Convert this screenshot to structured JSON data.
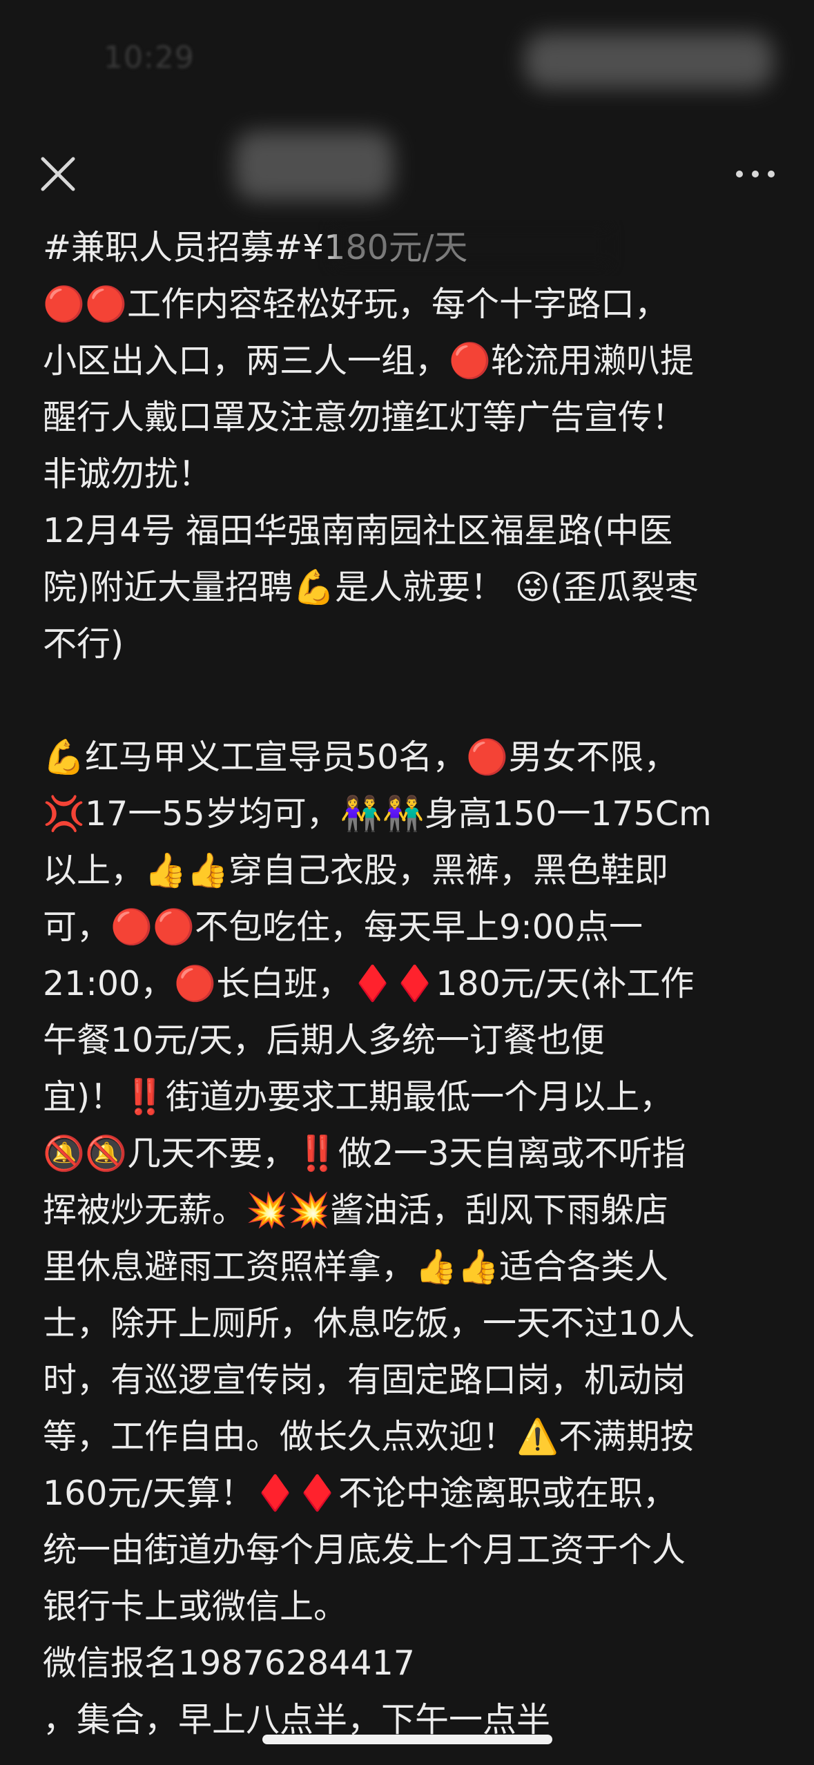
{
  "status_bar": {
    "time": "10:29"
  },
  "nav": {
    "close_icon": "close-icon",
    "more_icon": "more-icon"
  },
  "post": {
    "lines": [
      "#兼职人员招募#¥180元/天",
      "🔴🔴工作内容轻松好玩，每个十字路口，",
      "小区出入口，两三人一组，🔴轮流用濑叭提",
      "醒行人戴口罩及注意勿撞红灯等广告宣传！",
      "非诚勿扰！",
      "12月4号 福田华强南南园社区福星路(中医",
      "院)附近大量招聘💪是人就要！ 😜(歪瓜裂枣",
      "不行)",
      "",
      "💪红马甲义工宣导员50名，🔴男女不限，",
      "💢17一55岁均可，👫👫身高150一175Cm",
      "以上，👍👍穿自己衣股，黑裤，黑色鞋即",
      "可，🔴🔴不包吃住，每天早上9:00点一",
      "21:00，🔴长白班，♦️♦️180元/天(补工作",
      "午餐10元/天，后期人多统一订餐也便",
      "宜)！‼️街道办要求工期最低一个月以上，",
      "🔕🔕几天不要，‼️做2一3天自离或不听指",
      "挥被炒无薪。💥💥酱油活，刮风下雨躲店",
      "里休息避雨工资照样拿，👍👍适合各类人",
      "士，除开上厕所，休息吃饭，一天不过10人",
      "时，有巡逻宣传岗，有固定路口岗，机动岗",
      "等，工作自由。做长久点欢迎！⚠️不满期按",
      "160元/天算！♦️♦️不论中途离职或在职，",
      "统一由街道办每个月底发上个月工资于个人",
      "银行卡上或微信上。",
      "微信报名19876284417",
      "，集合，早上八点半，下午一点半"
    ]
  }
}
